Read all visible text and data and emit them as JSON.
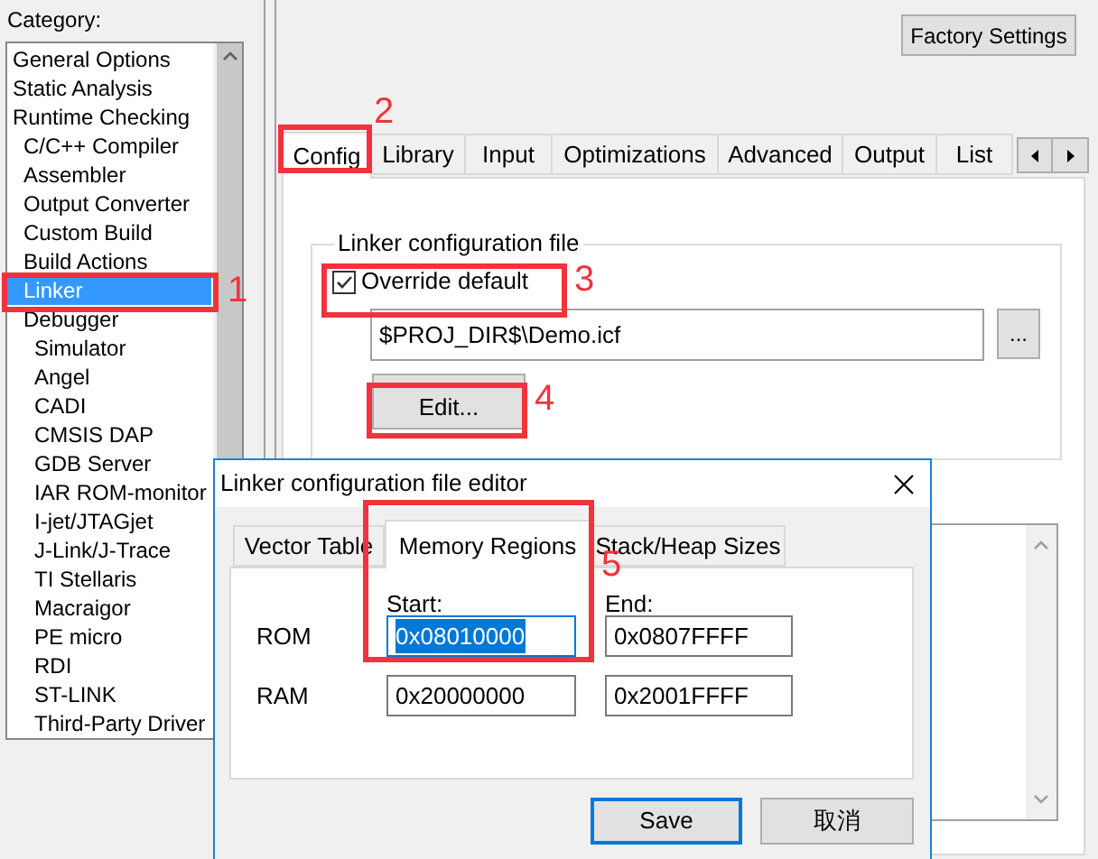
{
  "category_label": "Category:",
  "category_tree": [
    {
      "label": "General Options",
      "selected": false
    },
    {
      "label": "Static Analysis",
      "selected": false
    },
    {
      "label": "Runtime Checking",
      "selected": false,
      "children": [
        {
          "label": "C/C++ Compiler",
          "selected": false
        },
        {
          "label": "Assembler",
          "selected": false
        },
        {
          "label": "Output Converter",
          "selected": false
        },
        {
          "label": "Custom Build",
          "selected": false
        },
        {
          "label": "Build Actions",
          "selected": false
        },
        {
          "label": "Linker",
          "selected": true
        },
        {
          "label": "Debugger",
          "selected": false,
          "children": [
            {
              "label": "Simulator",
              "selected": false
            },
            {
              "label": "Angel",
              "selected": false
            },
            {
              "label": "CADI",
              "selected": false
            },
            {
              "label": "CMSIS DAP",
              "selected": false
            },
            {
              "label": "GDB Server",
              "selected": false
            },
            {
              "label": "IAR ROM-monitor",
              "selected": false
            },
            {
              "label": "I-jet/JTAGjet",
              "selected": false
            },
            {
              "label": "J-Link/J-Trace",
              "selected": false
            },
            {
              "label": "TI Stellaris",
              "selected": false
            },
            {
              "label": "Macraigor",
              "selected": false
            },
            {
              "label": "PE micro",
              "selected": false
            },
            {
              "label": "RDI",
              "selected": false
            },
            {
              "label": "ST-LINK",
              "selected": false
            },
            {
              "label": "Third-Party Driver",
              "selected": false
            }
          ]
        }
      ]
    }
  ],
  "factory_settings_button": "Factory Settings",
  "tabs": [
    {
      "label": "Config",
      "selected": true
    },
    {
      "label": "Library",
      "selected": false
    },
    {
      "label": "Input",
      "selected": false
    },
    {
      "label": "Optimizations",
      "selected": false
    },
    {
      "label": "Advanced",
      "selected": false
    },
    {
      "label": "Output",
      "selected": false
    },
    {
      "label": "List",
      "selected": false
    }
  ],
  "group": {
    "title": "Linker configuration file",
    "override_default": {
      "label": "Override default",
      "checked": true
    },
    "path": "$PROJ_DIR$\\Demo.icf",
    "browse_button": "...",
    "edit_button": "Edit..."
  },
  "dialog": {
    "title": "Linker configuration file editor",
    "tabs": [
      {
        "label": "Vector Table",
        "selected": false
      },
      {
        "label": "Memory Regions",
        "selected": true
      },
      {
        "label": "Stack/Heap Sizes",
        "selected": false
      }
    ],
    "columns": [
      "Start:",
      "End:"
    ],
    "regions": [
      {
        "name": "ROM",
        "start": "0x08010000",
        "start_selected": true,
        "end": "0x0807FFFF"
      },
      {
        "name": "RAM",
        "start": "0x20000000",
        "start_selected": false,
        "end": "0x2001FFFF"
      }
    ],
    "buttons": [
      {
        "label": "Save",
        "default": true
      },
      {
        "label": "取消",
        "default": false
      }
    ]
  },
  "annotations": [
    {
      "number": "1"
    },
    {
      "number": "2"
    },
    {
      "number": "3"
    },
    {
      "number": "4"
    },
    {
      "number": "5"
    }
  ]
}
